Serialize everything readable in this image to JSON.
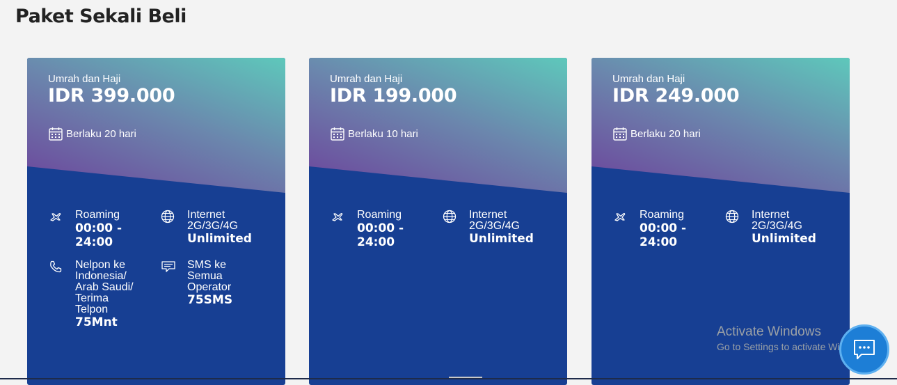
{
  "page": {
    "title": "Paket Sekali Beli"
  },
  "cards": [
    {
      "subtitle": "Umrah dan Haji",
      "price": "IDR 399.000",
      "validity": "Berlaku 20 hari",
      "features": {
        "roaming": {
          "label": "Roaming",
          "value_line1": "00:00 -",
          "value_line2": "24:00"
        },
        "internet": {
          "label_line1": "Internet",
          "label_line2": "2G/3G/4G",
          "value": "Unlimited"
        },
        "call": {
          "label_lines": [
            "Nelpon ke",
            "Indonesia/",
            "Arab Saudi/",
            "Terima",
            "Telpon"
          ],
          "value": "75Mnt"
        },
        "sms": {
          "label_lines": [
            "SMS ke",
            "Semua",
            "Operator"
          ],
          "value": "75SMS"
        }
      }
    },
    {
      "subtitle": "Umrah dan Haji",
      "price": "IDR 199.000",
      "validity": "Berlaku 10 hari",
      "features": {
        "roaming": {
          "label": "Roaming",
          "value_line1": "00:00 -",
          "value_line2": "24:00"
        },
        "internet": {
          "label_line1": "Internet",
          "label_line2": "2G/3G/4G",
          "value": "Unlimited"
        }
      }
    },
    {
      "subtitle": "Umrah dan Haji",
      "price": "IDR 249.000",
      "validity": "Berlaku 20 hari",
      "features": {
        "roaming": {
          "label": "Roaming",
          "value_line1": "00:00 -",
          "value_line2": "24:00"
        },
        "internet": {
          "label_line1": "Internet",
          "label_line2": "2G/3G/4G",
          "value": "Unlimited"
        }
      }
    }
  ],
  "watermark": {
    "line1": "Activate Windows",
    "line2": "Go to Settings to activate Windows."
  },
  "chat_button": {
    "icon": "chat-icon"
  },
  "colors": {
    "card_bottom": "#173f93",
    "gradient_teal": "#5ec8bb",
    "gradient_purple": "#6d3f9a",
    "chat_button": "#1d7ed6"
  }
}
